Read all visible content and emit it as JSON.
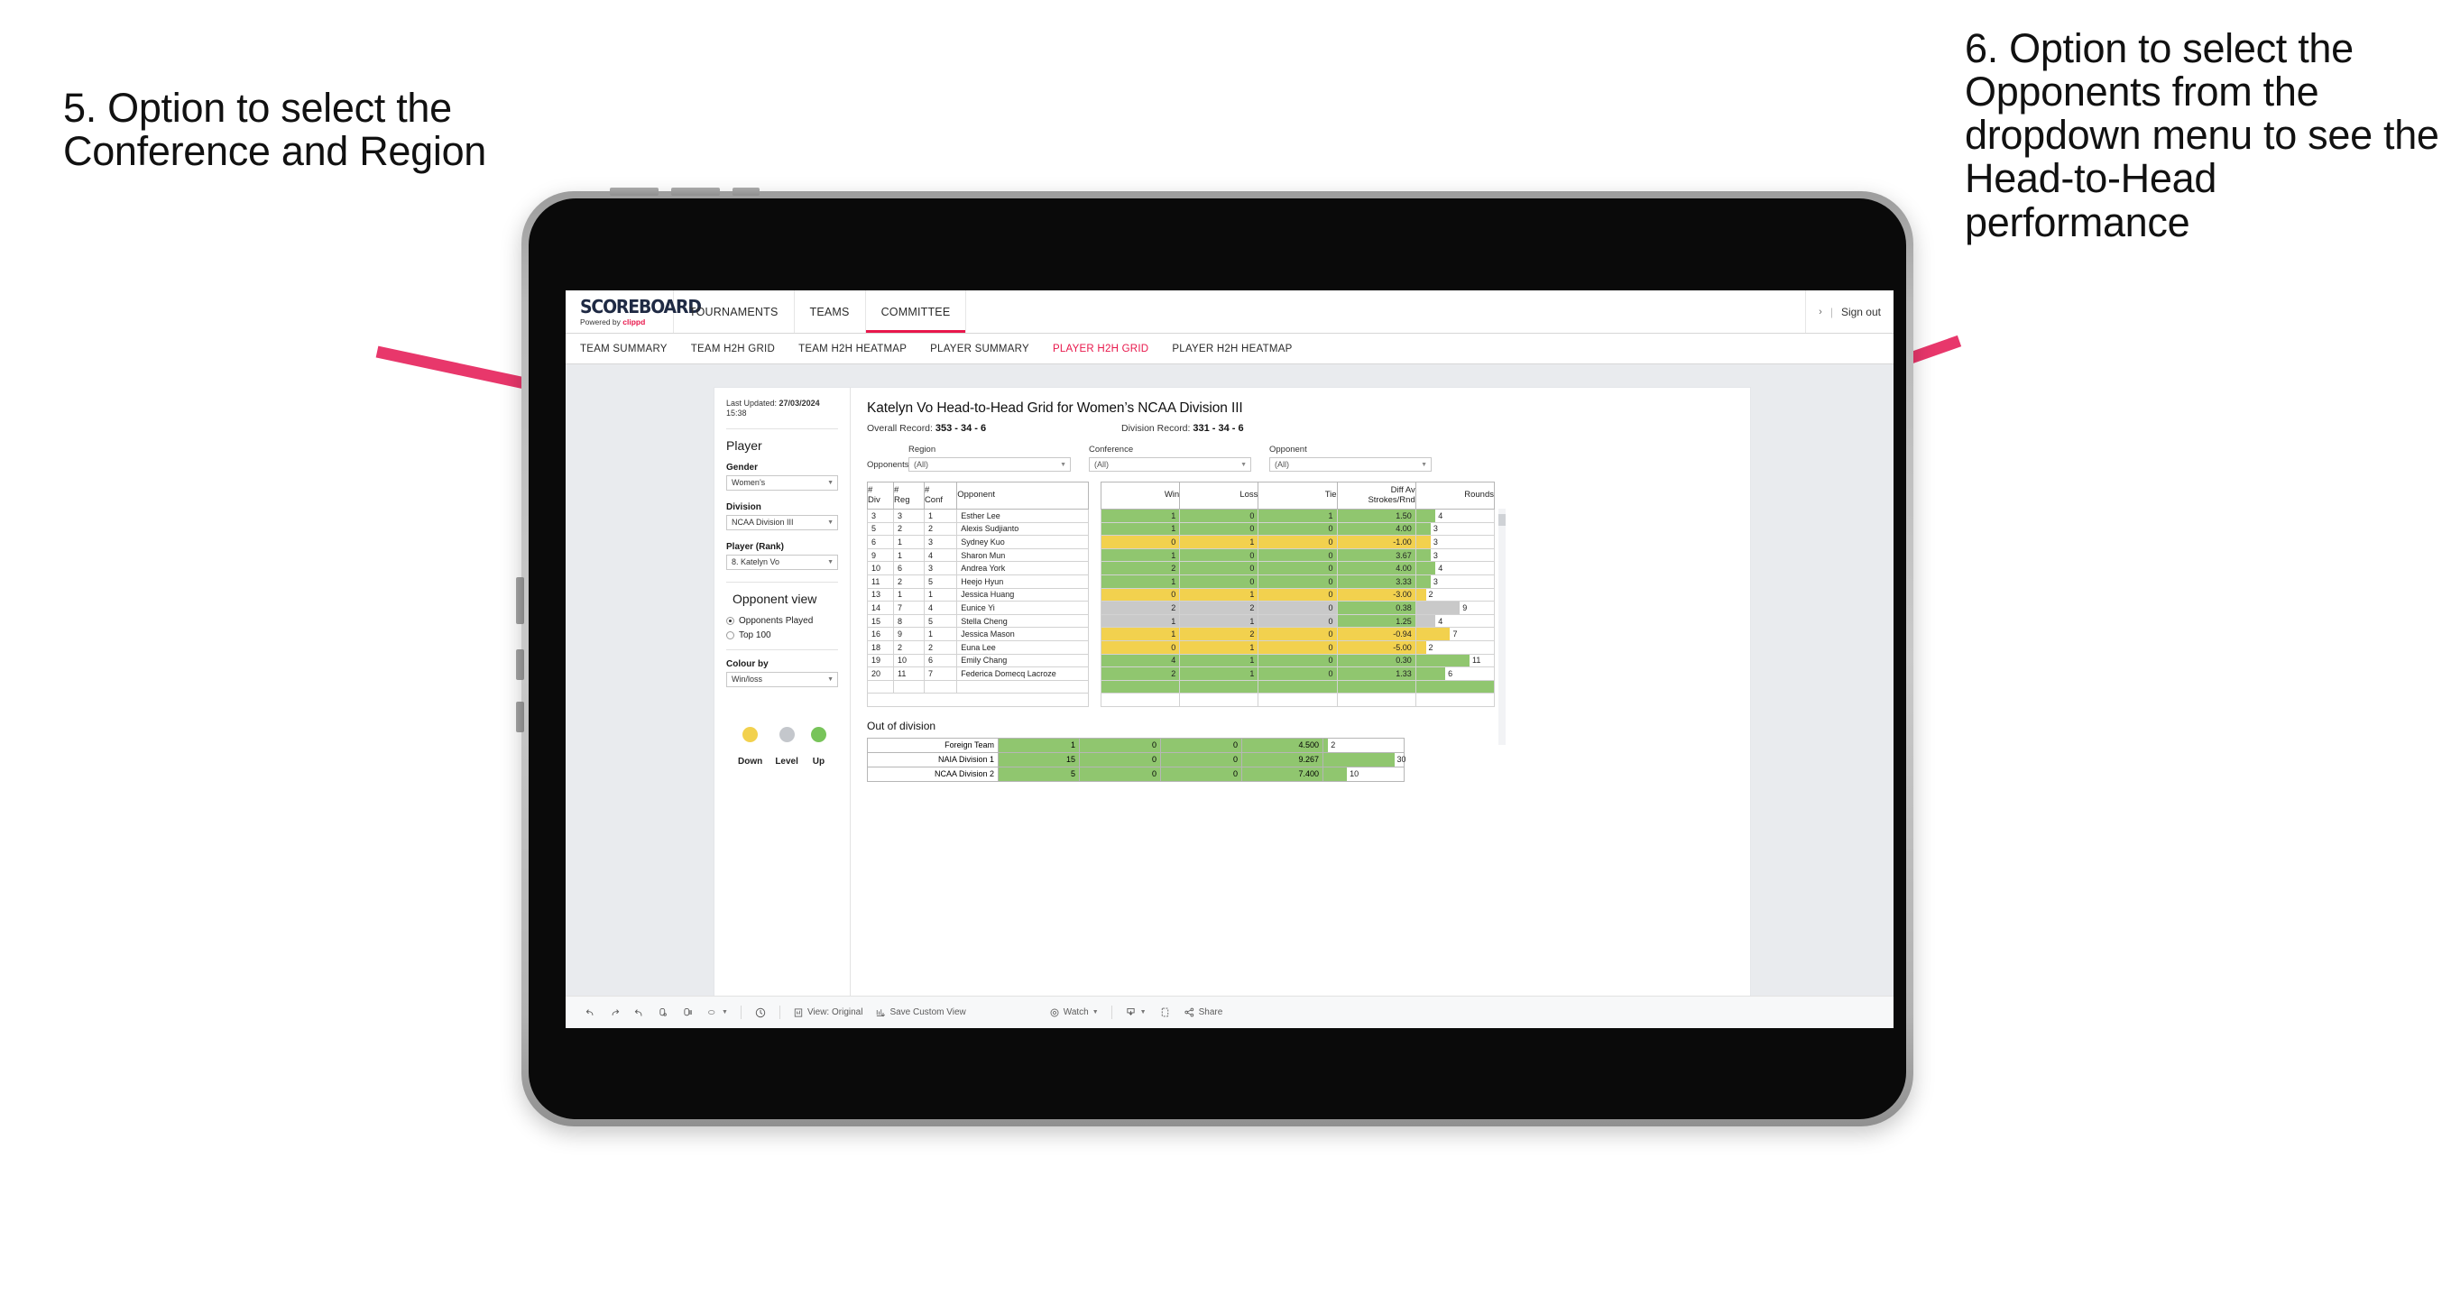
{
  "annotations": {
    "left": "5. Option to select the Conference and Region",
    "right": "6. Option to select the Opponents from the dropdown menu to see the Head-to-Head performance"
  },
  "colors": {
    "accent": "#e8174b",
    "green": "#90c66f",
    "yellow": "#f2d14e",
    "grey": "#c9c9c9",
    "legend_down": "#f2d14e",
    "legend_level": "#c4c7cc",
    "legend_up": "#78c45a"
  },
  "topnav": {
    "logo": "SCOREBOARD",
    "logo_sub_prefix": "Powered by ",
    "logo_sub_brand": "clippd",
    "items": [
      {
        "label": "TOURNAMENTS",
        "active": false
      },
      {
        "label": "TEAMS",
        "active": false
      },
      {
        "label": "COMMITTEE",
        "active": true
      }
    ],
    "chevron": "›",
    "separator": "|",
    "signout": "Sign out"
  },
  "subnav": {
    "tabs": [
      {
        "label": "TEAM SUMMARY",
        "active": false
      },
      {
        "label": "TEAM H2H GRID",
        "active": false
      },
      {
        "label": "TEAM H2H HEATMAP",
        "active": false
      },
      {
        "label": "PLAYER SUMMARY",
        "active": false
      },
      {
        "label": "PLAYER H2H GRID",
        "active": true
      },
      {
        "label": "PLAYER H2H HEATMAP",
        "active": false
      }
    ]
  },
  "sidebar": {
    "last_updated_label": "Last Updated: ",
    "last_updated_value": "27/03/2024",
    "last_updated_time": "15:38",
    "player_heading": "Player",
    "fields": [
      {
        "label": "Gender",
        "value": "Women’s"
      },
      {
        "label": "Division",
        "value": "NCAA Division III"
      },
      {
        "label": "Player (Rank)",
        "value": "8. Katelyn Vo"
      }
    ],
    "opponent_view_heading": "Opponent view",
    "radios": [
      {
        "label": "Opponents Played",
        "selected": true
      },
      {
        "label": "Top 100",
        "selected": false
      }
    ],
    "colour_by_label": "Colour by",
    "colour_by_value": "Win/loss",
    "legend": [
      {
        "label": "Down",
        "color": "#f2d14e"
      },
      {
        "label": "Level",
        "color": "#c4c7cc"
      },
      {
        "label": "Up",
        "color": "#78c45a"
      }
    ]
  },
  "main": {
    "title": "Katelyn Vo Head-to-Head Grid for Women’s NCAA Division III",
    "overall_label": "Overall Record: ",
    "overall_value": "353 - 34 - 6",
    "division_label": "Division Record: ",
    "division_value": "331 -  34 - 6",
    "opponents_label": "Opponents:",
    "filters": [
      {
        "label": "Region",
        "value": "(All)"
      },
      {
        "label": "Conference",
        "value": "(All)"
      },
      {
        "label": "Opponent",
        "value": "(All)"
      }
    ],
    "out_of_division_title": "Out of division"
  },
  "table": {
    "columns": [
      {
        "key": "div",
        "line1": "#",
        "line2": "Div"
      },
      {
        "key": "reg",
        "line1": "#",
        "line2": "Reg"
      },
      {
        "key": "conf",
        "line1": "#",
        "line2": "Conf"
      },
      {
        "key": "opponent",
        "line1": "Opponent",
        "line2": ""
      },
      {
        "key": "win",
        "line1": "Win",
        "line2": ""
      },
      {
        "key": "loss",
        "line1": "Loss",
        "line2": ""
      },
      {
        "key": "tie",
        "line1": "Tie",
        "line2": ""
      },
      {
        "key": "diff",
        "line1": "Diff Av",
        "line2": "Strokes/Rnd"
      },
      {
        "key": "rounds",
        "line1": "Rounds",
        "line2": ""
      }
    ],
    "rows": [
      {
        "div": "3",
        "reg": "3",
        "conf": "1",
        "opponent": "Esther Lee",
        "win": "1",
        "loss": "0",
        "tie": "1",
        "diff": "1.50",
        "rounds": "4",
        "status": "up"
      },
      {
        "div": "5",
        "reg": "2",
        "conf": "2",
        "opponent": "Alexis Sudjianto",
        "win": "1",
        "loss": "0",
        "tie": "0",
        "diff": "4.00",
        "rounds": "3",
        "status": "up"
      },
      {
        "div": "6",
        "reg": "1",
        "conf": "3",
        "opponent": "Sydney Kuo",
        "win": "0",
        "loss": "1",
        "tie": "0",
        "diff": "-1.00",
        "rounds": "3",
        "status": "down"
      },
      {
        "div": "9",
        "reg": "1",
        "conf": "4",
        "opponent": "Sharon Mun",
        "win": "1",
        "loss": "0",
        "tie": "0",
        "diff": "3.67",
        "rounds": "3",
        "status": "up"
      },
      {
        "div": "10",
        "reg": "6",
        "conf": "3",
        "opponent": "Andrea York",
        "win": "2",
        "loss": "0",
        "tie": "0",
        "diff": "4.00",
        "rounds": "4",
        "status": "up"
      },
      {
        "div": "11",
        "reg": "2",
        "conf": "5",
        "opponent": "Heejo Hyun",
        "win": "1",
        "loss": "0",
        "tie": "0",
        "diff": "3.33",
        "rounds": "3",
        "status": "up"
      },
      {
        "div": "13",
        "reg": "1",
        "conf": "1",
        "opponent": "Jessica Huang",
        "win": "0",
        "loss": "1",
        "tie": "0",
        "diff": "-3.00",
        "rounds": "2",
        "status": "down"
      },
      {
        "div": "14",
        "reg": "7",
        "conf": "4",
        "opponent": "Eunice Yi",
        "win": "2",
        "loss": "2",
        "tie": "0",
        "diff": "0.38",
        "rounds": "9",
        "status": "level",
        "diff_status": "up"
      },
      {
        "div": "15",
        "reg": "8",
        "conf": "5",
        "opponent": "Stella Cheng",
        "win": "1",
        "loss": "1",
        "tie": "0",
        "diff": "1.25",
        "rounds": "4",
        "status": "level",
        "diff_status": "up"
      },
      {
        "div": "16",
        "reg": "9",
        "conf": "1",
        "opponent": "Jessica Mason",
        "win": "1",
        "loss": "2",
        "tie": "0",
        "diff": "-0.94",
        "rounds": "7",
        "status": "down"
      },
      {
        "div": "18",
        "reg": "2",
        "conf": "2",
        "opponent": "Euna Lee",
        "win": "0",
        "loss": "1",
        "tie": "0",
        "diff": "-5.00",
        "rounds": "2",
        "status": "down"
      },
      {
        "div": "19",
        "reg": "10",
        "conf": "6",
        "opponent": "Emily Chang",
        "win": "4",
        "loss": "1",
        "tie": "0",
        "diff": "0.30",
        "rounds": "11",
        "status": "up"
      },
      {
        "div": "20",
        "reg": "11",
        "conf": "7",
        "opponent": "Federica Domecq Lacroze",
        "win": "2",
        "loss": "1",
        "tie": "0",
        "diff": "1.33",
        "rounds": "6",
        "status": "up"
      }
    ],
    "rounds_max": 16
  },
  "out_of_division": {
    "rows": [
      {
        "name": "Foreign Team",
        "win": "1",
        "loss": "0",
        "tie": "0",
        "diff": "4.500",
        "rounds": "2",
        "status": "up"
      },
      {
        "name": "NAIA Division 1",
        "win": "15",
        "loss": "0",
        "tie": "0",
        "diff": "9.267",
        "rounds": "30",
        "status": "up"
      },
      {
        "name": "NCAA Division 2",
        "win": "5",
        "loss": "0",
        "tie": "0",
        "diff": "7.400",
        "rounds": "10",
        "status": "up"
      }
    ],
    "rounds_max": 34
  },
  "bottombar": {
    "view_label": "View: Original",
    "save_label": "Save Custom View",
    "watch_label": "Watch",
    "share_label": "Share"
  }
}
